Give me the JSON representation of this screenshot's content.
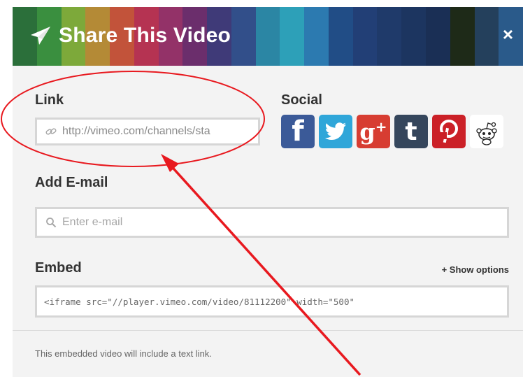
{
  "header": {
    "title": "Share This Video",
    "close_label": "×",
    "icon": "paper-plane-icon",
    "stripe_colors": [
      "#2b6f3a",
      "#3a8f3f",
      "#7da93a",
      "#b48a36",
      "#c2533a",
      "#b53352",
      "#933268",
      "#6b2e6c",
      "#3f3a78",
      "#324f8a",
      "#2b86a4",
      "#2da0b8",
      "#2c7ab0",
      "#214d86",
      "#223f76",
      "#1f3a6a",
      "#1c3560",
      "#1a2f55",
      "#1e2a18",
      "#24405c",
      "#2a5a8a"
    ]
  },
  "link": {
    "label": "Link",
    "value": "http://vimeo.com/channels/sta",
    "icon": "link-icon"
  },
  "social": {
    "label": "Social",
    "buttons": [
      {
        "name": "facebook",
        "glyph": "f",
        "color": "#3b5a98"
      },
      {
        "name": "twitter",
        "glyph": "bird",
        "color": "#2fa6d9"
      },
      {
        "name": "google-plus",
        "glyph": "g+",
        "color": "#d73d32"
      },
      {
        "name": "tumblr",
        "glyph": "t",
        "color": "#35465c"
      },
      {
        "name": "pinterest",
        "glyph": "p",
        "color": "#cb2027"
      },
      {
        "name": "reddit",
        "glyph": "alien",
        "color": "#ffffff"
      }
    ]
  },
  "email": {
    "label": "Add E-mail",
    "placeholder": "Enter e-mail",
    "icon": "search-icon"
  },
  "embed": {
    "label": "Embed",
    "show_options": "+ Show options",
    "code": "<iframe src=\"//player.vimeo.com/video/81112200\" width=\"500\""
  },
  "footnote": "This embedded video will include a text link.",
  "annotation": {
    "color": "#e8191f"
  }
}
